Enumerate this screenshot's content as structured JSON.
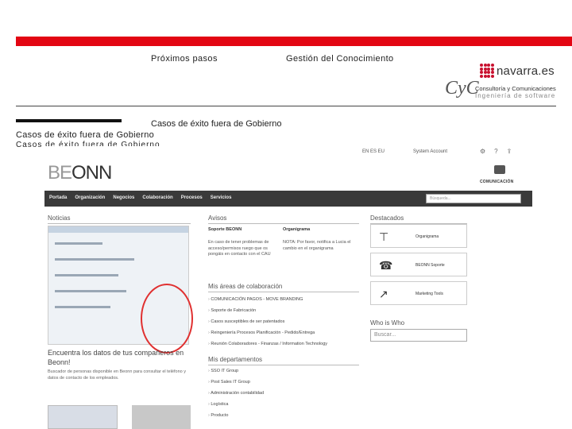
{
  "header": {
    "nav_links": [
      "Próximos pasos",
      "Gestión del Conocimiento"
    ],
    "breadcrumb": "Casos de éxito fuera de Gobierno",
    "section_title": "Casos de éxito fuera de Gobierno",
    "section_subtitle": "Casos de éxito fuera de Gobierno",
    "navarra_logo_text": "navarra.es",
    "cyc_mark": "CyC",
    "cyc_line1": "Consultoría y Comunicaciones",
    "cyc_line2": "Ingeniería de software",
    "accent_color": "#e30613"
  },
  "intranet": {
    "lang": "EN ES EU",
    "user": "System Account",
    "brand_be": "BE",
    "brand_onn": "ONN",
    "communication_label": "COMUNICACIÓN",
    "menu": [
      "Portada",
      "Organización",
      "Negocios",
      "Colaboración",
      "Procesos",
      "Servicios"
    ],
    "search_placeholder": "Búsqueda...",
    "news": {
      "heading": "Noticias",
      "title": "Encuentra los datos de tus compañeros en Beonn!",
      "text": "Buscador de personas disponible en Beonn para consultar el teléfono y datos de contacto de los empleados."
    },
    "avisos": {
      "heading": "Avisos",
      "soporte_title": "Soporte BEONN",
      "soporte_text": "En caso de tener problemas de acceso/permisos ruego que os pongáis en contacto con el CAU",
      "organigrama_title": "Organigrama",
      "organigrama_text": "NOTA: Por favor, notifica a Lucia el cambio en el organigrama"
    },
    "areas": {
      "heading": "Mis áreas de colaboración",
      "items": [
        "COMUNICACIÓN PAGOS - MOVE BRANDING",
        "Soporte de Fabricación",
        "Casos susceptibles de ser patentados",
        "Reingeniería Procesos Planificación - Pedido/Entrega",
        "Reunión Colaboradores - Finanzas / Information Technology"
      ]
    },
    "deptos": {
      "heading": "Mis departamentos",
      "items": [
        "SSO IT Group",
        "Post Sales IT Group",
        "Administración contabilidad",
        "Logística",
        "Producto"
      ]
    },
    "destacados": {
      "heading": "Destacados",
      "items": [
        {
          "label": "Organigrama",
          "icon": "org-chart-icon"
        },
        {
          "label": "BEONN Soporte",
          "icon": "headset-icon"
        },
        {
          "label": "Marketing Tools",
          "icon": "growth-chart-icon"
        }
      ]
    },
    "who": {
      "heading": "Who is Who",
      "placeholder": "Buscar..."
    }
  }
}
